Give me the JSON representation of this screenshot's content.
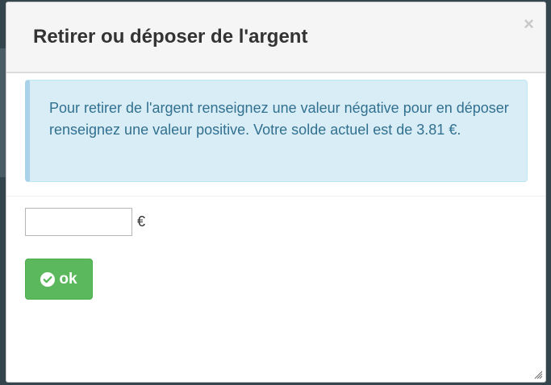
{
  "dialog": {
    "title": "Retirer ou déposer de l'argent",
    "close_label": "×",
    "info_text": "Pour retirer de l'argent renseignez une valeur négative pour en déposer renseignez une valeur positive. Votre solde actuel est de 3.81 €.",
    "amount_value": "",
    "amount_placeholder": "",
    "currency_symbol": "€",
    "ok_label": "ok"
  },
  "colors": {
    "ok_button": "#5cb85c",
    "alert_background": "#d9edf7",
    "alert_text": "#31708f"
  },
  "icons": {
    "ok": "check-circle-icon",
    "close": "close-icon",
    "resize": "resize-handle-icon"
  }
}
